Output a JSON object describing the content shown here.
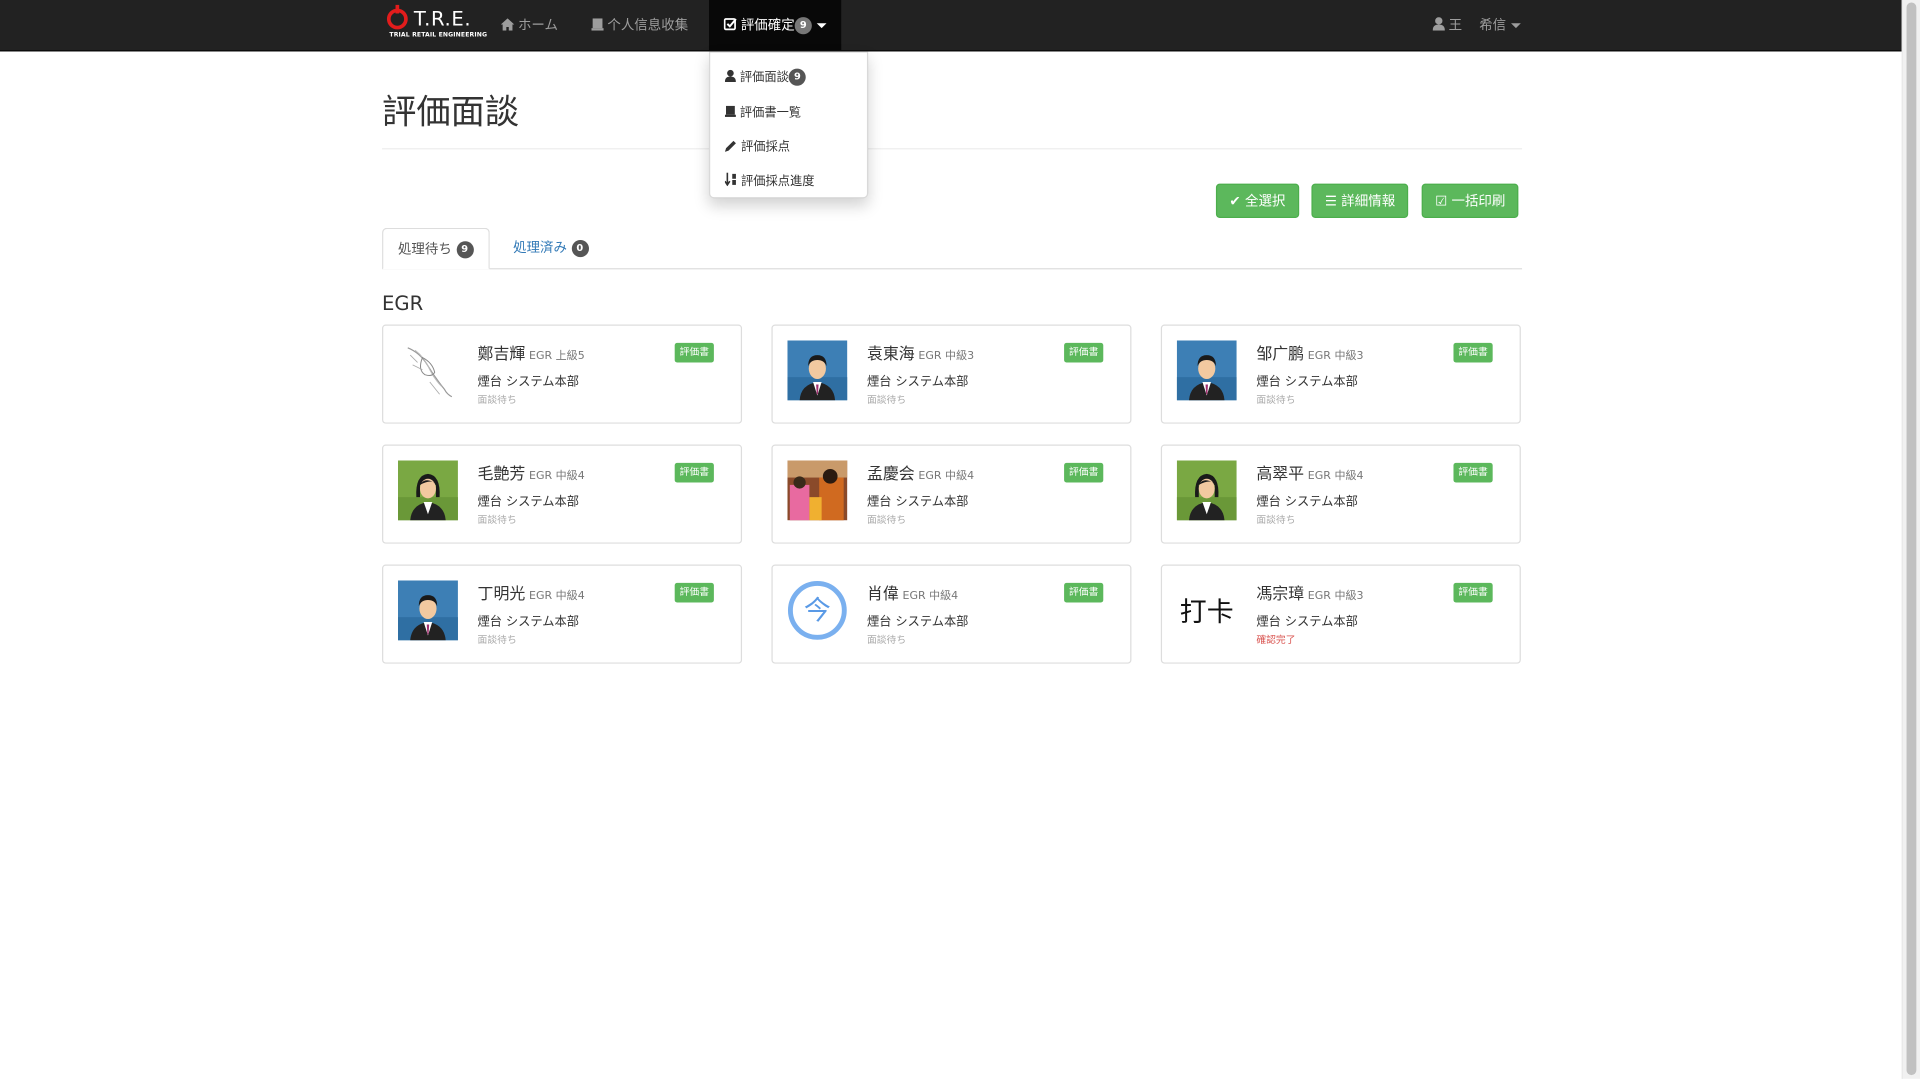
{
  "navbar": {
    "brand_text": "T.R.E.",
    "brand_sub": "TRIAL RETAIL ENGINEERING",
    "home": "ホーム",
    "personal_info": "个人信息收集",
    "evaluation": "評価確定",
    "evaluation_badge": "9",
    "user_icon_label": "王",
    "user_name": "希信"
  },
  "dropdown": {
    "items": [
      {
        "label": "評価面談",
        "badge": "9",
        "icon": "user-icon"
      },
      {
        "label": "評価書一覧",
        "icon": "book-icon"
      },
      {
        "label": "評価採点",
        "icon": "pencil-icon"
      },
      {
        "label": "評価採点進度",
        "icon": "sort-icon"
      }
    ]
  },
  "page": {
    "title": "評価面談",
    "select_all": "全選択",
    "detail_info": "詳細情報",
    "batch_print": "一括印刷",
    "tab_pending": "処理待ち",
    "tab_pending_badge": "9",
    "tab_done": "処理済み",
    "tab_done_badge": "0",
    "section": "EGR"
  },
  "cards": [
    {
      "name": "鄭吉輝",
      "grade": "EGR 上級5",
      "dept": "煙台 システム本部",
      "status": "面談待ち",
      "label": "評価書",
      "avatar": "sketch"
    },
    {
      "name": "袁東海",
      "grade": "EGR 中級3",
      "dept": "煙台 システム本部",
      "status": "面談待ち",
      "label": "評価書",
      "avatar": "male"
    },
    {
      "name": "邹广鹏",
      "grade": "EGR 中級3",
      "dept": "煙台 システム本部",
      "status": "面談待ち",
      "label": "評価書",
      "avatar": "male"
    },
    {
      "name": "毛艶芳",
      "grade": "EGR 中級4",
      "dept": "煙台 システム本部",
      "status": "面談待ち",
      "label": "評価書",
      "avatar": "female"
    },
    {
      "name": "孟慶会",
      "grade": "EGR 中級4",
      "dept": "煙台 システム本部",
      "status": "面談待ち",
      "label": "評価書",
      "avatar": "photo"
    },
    {
      "name": "高翠平",
      "grade": "EGR 中級4",
      "dept": "煙台 システム本部",
      "status": "面談待ち",
      "label": "評価書",
      "avatar": "female"
    },
    {
      "name": "丁明光",
      "grade": "EGR 中級4",
      "dept": "煙台 システム本部",
      "status": "面談待ち",
      "label": "評価書",
      "avatar": "male"
    },
    {
      "name": "肖偉",
      "grade": "EGR 中級4",
      "dept": "煙台 システム本部",
      "status": "面談待ち",
      "label": "評価書",
      "avatar": "circle",
      "avatar_text": "今"
    },
    {
      "name": "馮宗璋",
      "grade": "EGR 中級3",
      "dept": "煙台 システム本部",
      "status": "確認完了",
      "label": "評価書",
      "avatar": "text",
      "avatar_text": "打卡"
    }
  ],
  "colors": {
    "navbar": "#222222",
    "green": "#5cb85c",
    "link": "#337ab7",
    "done_status": "#d9534f",
    "logo_red": "#e21c1c"
  }
}
